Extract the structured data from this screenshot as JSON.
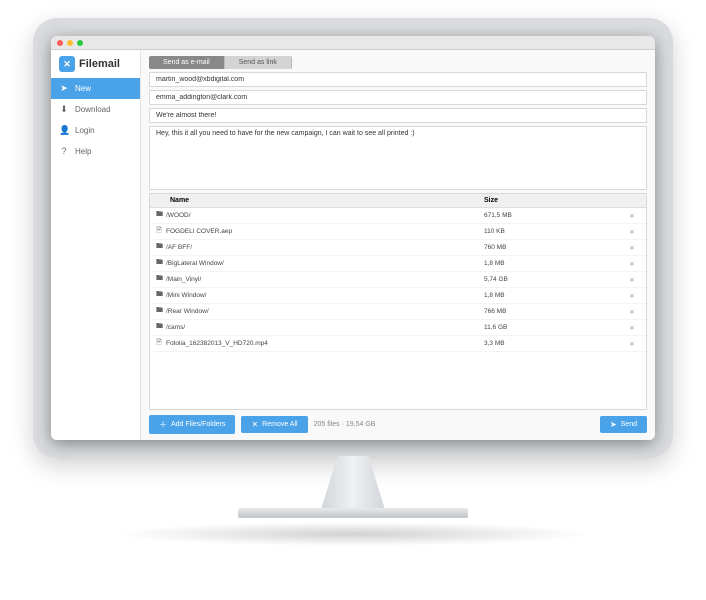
{
  "brand": {
    "name": "Filemail"
  },
  "sidebar": {
    "items": [
      {
        "icon": "➤",
        "label": "New",
        "active": true
      },
      {
        "icon": "⬇",
        "label": "Download",
        "active": false
      },
      {
        "icon": "👤",
        "label": "Login",
        "active": false
      },
      {
        "icon": "?",
        "label": "Help",
        "active": false
      }
    ]
  },
  "tabs": [
    {
      "label": "Send as e-mail",
      "active": true
    },
    {
      "label": "Send as link",
      "active": false
    }
  ],
  "form": {
    "to": "martin_wood@xbdigital.com",
    "from": "emma_addington@clark.com",
    "subject": "We're almost there!",
    "message": "Hey, this it all you need to have for the new campaign, I can wait to see all printed :)"
  },
  "table": {
    "headers": {
      "name": "Name",
      "size": "Size"
    }
  },
  "files": [
    {
      "icon": "folder",
      "name": "/WOOD/",
      "size": "671,5 MB"
    },
    {
      "icon": "file",
      "name": "FOGDELI COVER.aep",
      "size": "110 KB"
    },
    {
      "icon": "folder",
      "name": "/AF BFF/",
      "size": "760 MB"
    },
    {
      "icon": "folder",
      "name": "/BigLateral Window/",
      "size": "1,8 MB"
    },
    {
      "icon": "folder",
      "name": "/Main_Vinyl/",
      "size": "5,74 GB"
    },
    {
      "icon": "folder",
      "name": "/Mini Window/",
      "size": "1,8 MB"
    },
    {
      "icon": "folder",
      "name": "/Rear Window/",
      "size": "766 MB"
    },
    {
      "icon": "folder",
      "name": "/cams/",
      "size": "11,6 GB"
    },
    {
      "icon": "file",
      "name": "Fotolia_162382013_V_HD720.mp4",
      "size": "3,3 MB"
    }
  ],
  "buttons": {
    "add": "Add Files/Folders",
    "remove": "Remove All",
    "send": "Send"
  },
  "summary": "205 files · 19,54 GB"
}
